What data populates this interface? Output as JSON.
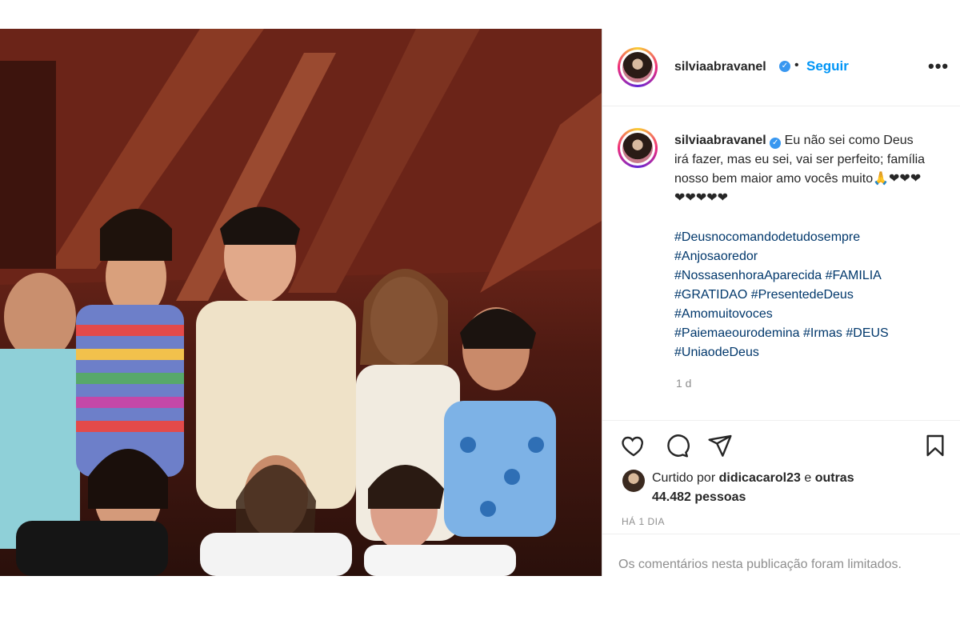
{
  "post": {
    "username": "silviaabravanel",
    "verified": true,
    "follow_label": "Seguir",
    "more_label": "•••",
    "caption_text": "Eu não sei como Deus irá fazer, mas eu sei, vai ser perfeito; família nosso bem maior amo vocês muito🙏❤❤❤❤❤❤❤❤",
    "hashtags": [
      "#Deusnocomandodetudosempre",
      "#Anjosaoredor",
      "#NossasenhoraAparecida",
      "#FAMILIA",
      "#GRATIDAO",
      "#PresentedeDeus",
      "#Amomuitovoces",
      "#Paiemaeourodemina",
      "#Irmas",
      "#DEUS",
      "#UniaodeDeus"
    ],
    "caption_time": "1 d",
    "liked_prefix": "Curtido por",
    "liked_user": "didicacarol23",
    "liked_joiner": "e",
    "liked_others": "outras 44.482 pessoas",
    "posted_ago": "HÁ 1 DIA",
    "comments_limited": "Os comentários nesta publicação foram limitados."
  },
  "icons": {
    "like": "heart-icon",
    "comment": "comment-icon",
    "share": "share-icon",
    "save": "bookmark-icon",
    "more": "more-icon",
    "verified": "verified-badge-icon"
  },
  "colors": {
    "link": "#0095f6",
    "hashtag": "#00376b",
    "muted": "#8e8e8e",
    "verified": "#3897f0"
  }
}
